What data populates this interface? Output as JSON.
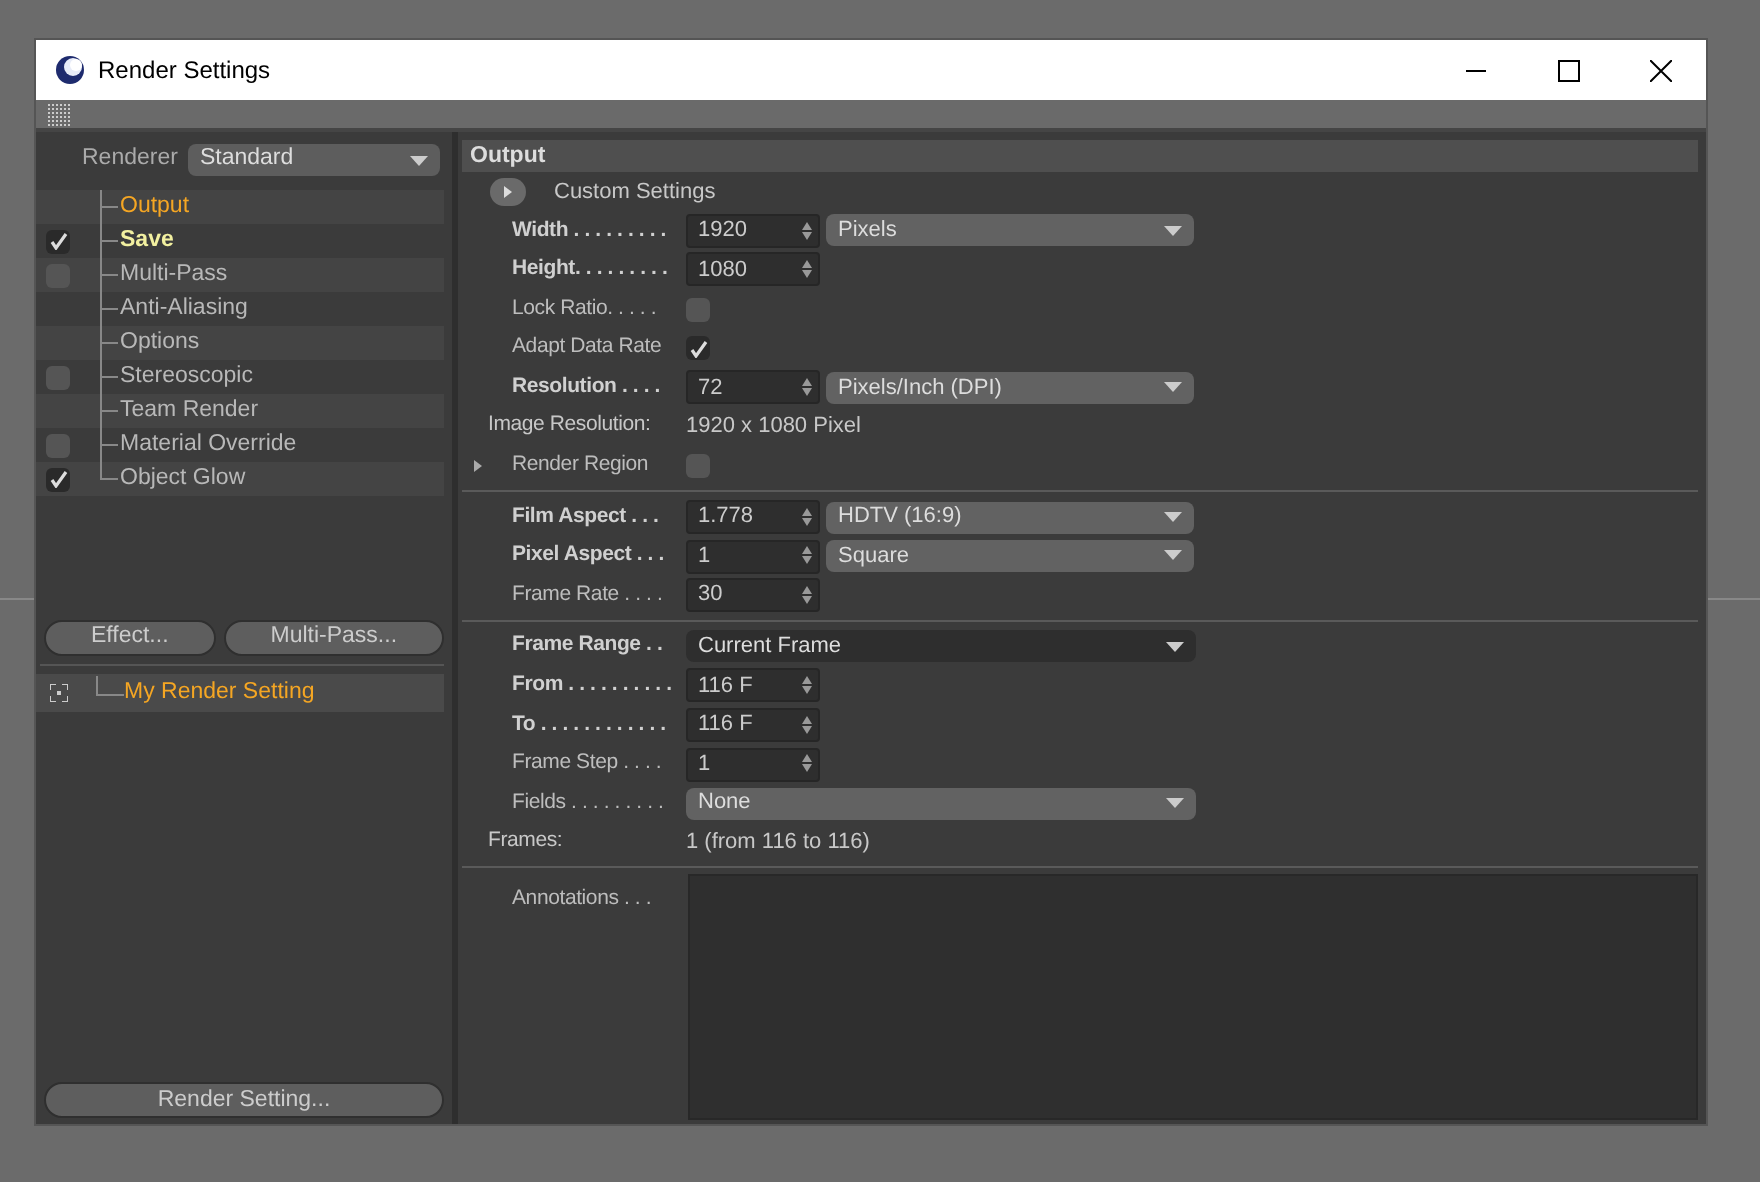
{
  "window": {
    "title": "Render Settings"
  },
  "renderer": {
    "label": "Renderer",
    "value": "Standard"
  },
  "tree": [
    {
      "label": "Output",
      "kind": "plain",
      "selected": true,
      "active": false
    },
    {
      "label": "Save",
      "kind": "checkbox",
      "checked": true,
      "selected": false,
      "active": true
    },
    {
      "label": "Multi-Pass",
      "kind": "checkbox",
      "checked": false,
      "selected": false,
      "active": false
    },
    {
      "label": "Anti-Aliasing",
      "kind": "plain",
      "selected": false,
      "active": false
    },
    {
      "label": "Options",
      "kind": "plain",
      "selected": false,
      "active": false
    },
    {
      "label": "Stereoscopic",
      "kind": "checkbox",
      "checked": false,
      "selected": false,
      "active": false
    },
    {
      "label": "Team Render",
      "kind": "plain",
      "selected": false,
      "active": false
    },
    {
      "label": "Material Override",
      "kind": "checkbox",
      "checked": false,
      "selected": false,
      "active": false
    },
    {
      "label": "Object Glow",
      "kind": "checkbox",
      "checked": true,
      "selected": false,
      "active": false
    }
  ],
  "buttons": [
    "Effect...",
    "Multi-Pass..."
  ],
  "render_settings_list": [
    {
      "label": "My Render Setting",
      "selected": true
    }
  ],
  "bottom_button": "Render Setting...",
  "panel": {
    "title": "Output",
    "rows": [
      {
        "kind": "expander",
        "label": "Custom Settings"
      },
      {
        "kind": "number",
        "label": "Width . . . . . . . . .",
        "bold": true,
        "value": "1920",
        "unit": "Pixels"
      },
      {
        "kind": "number",
        "label": "Height. . . . . . . . .",
        "bold": true,
        "value": "1080"
      },
      {
        "kind": "checkbox",
        "label": "Lock Ratio. . . . .",
        "checked": false
      },
      {
        "kind": "checkbox",
        "label": "Adapt Data Rate",
        "checked": true
      },
      {
        "kind": "number",
        "label": "Resolution . . . .",
        "bold": true,
        "value": "72",
        "unit": "Pixels/Inch (DPI)"
      },
      {
        "kind": "info",
        "label": "Image Resolution:",
        "value": "1920 x 1080 Pixel"
      },
      {
        "kind": "checkbox",
        "label": "Render Region",
        "checked": false,
        "expandable": true
      },
      {
        "kind": "separator"
      },
      {
        "kind": "number",
        "label": "Film Aspect . . .",
        "bold": true,
        "value": "1.778",
        "unit": "HDTV (16:9)"
      },
      {
        "kind": "number",
        "label": "Pixel Aspect . . .",
        "bold": true,
        "value": "1",
        "unit": "Square"
      },
      {
        "kind": "number",
        "label": "Frame Rate . . . .",
        "bold": false,
        "value": "30"
      },
      {
        "kind": "separator"
      },
      {
        "kind": "select",
        "label": "Frame Range . .",
        "bold": true,
        "value": "Current Frame",
        "dark": true
      },
      {
        "kind": "number",
        "label": "From . . . . . . . . . .",
        "bold": true,
        "value": "116 F"
      },
      {
        "kind": "number",
        "label": "To . . . . . . . . . . . .",
        "bold": true,
        "value": "116 F"
      },
      {
        "kind": "number",
        "label": "Frame Step . . . .",
        "bold": false,
        "value": "1"
      },
      {
        "kind": "select",
        "label": "Fields . . . . . . . . .",
        "bold": false,
        "value": "None",
        "dark": false
      },
      {
        "kind": "info",
        "label": "Frames:",
        "value": "1 (from 116 to 116)"
      },
      {
        "kind": "separator"
      },
      {
        "kind": "textarea",
        "label": "Annotations . . ."
      }
    ]
  }
}
